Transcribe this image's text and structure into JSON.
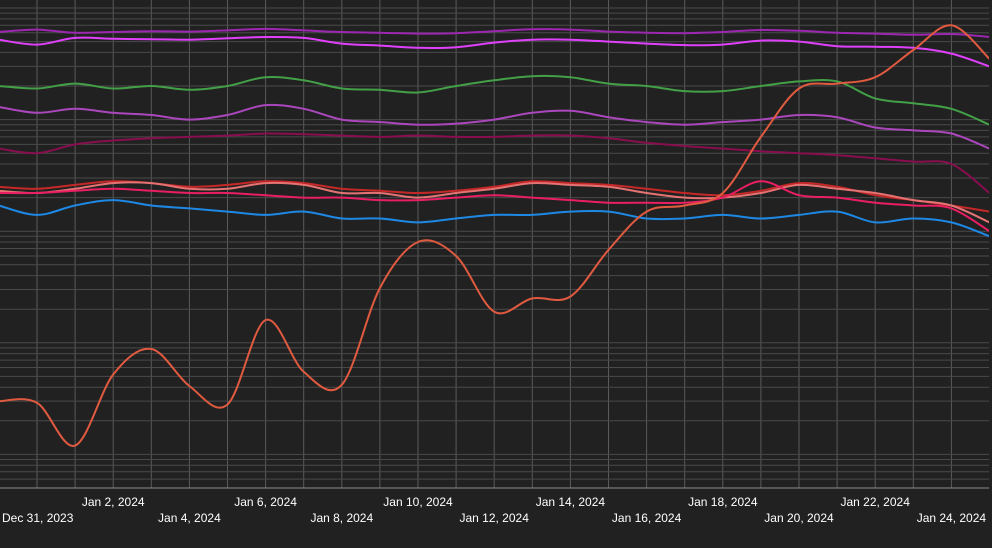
{
  "chart_data": {
    "type": "line",
    "title": "",
    "xlabel": "",
    "ylabel": "",
    "y_scale": "log",
    "y_tick_labels_visible": false,
    "grid": true,
    "background": "#212121",
    "x_tick_labels": [
      "Dec 31, 2023",
      "Jan 2, 2024",
      "Jan 4, 2024",
      "Jan 6, 2024",
      "Jan 8, 2024",
      "Jan 10, 2024",
      "Jan 12, 2024",
      "Jan 14, 2024",
      "Jan 16, 2024",
      "Jan 18, 2024",
      "Jan 20, 2024",
      "Jan 22, 2024",
      "Jan 24, 2024"
    ],
    "x": [
      "2023-12-30",
      "2023-12-31",
      "2024-01-01",
      "2024-01-02",
      "2024-01-03",
      "2024-01-04",
      "2024-01-05",
      "2024-01-06",
      "2024-01-07",
      "2024-01-08",
      "2024-01-09",
      "2024-01-10",
      "2024-01-11",
      "2024-01-12",
      "2024-01-13",
      "2024-01-14",
      "2024-01-15",
      "2024-01-16",
      "2024-01-17",
      "2024-01-18",
      "2024-01-19",
      "2024-01-20",
      "2024-01-21",
      "2024-01-22",
      "2024-01-23",
      "2024-01-24",
      "2024-01-25"
    ],
    "ylim": [
      0.05,
      1000
    ],
    "series": [
      {
        "color": "#9c27b0",
        "values": [
          610,
          640,
          600,
          610,
          620,
          615,
          630,
          650,
          630,
          610,
          600,
          590,
          595,
          620,
          645,
          640,
          615,
          600,
          595,
          610,
          635,
          625,
          600,
          590,
          575,
          585,
          550
        ]
      },
      {
        "color": "#e040fb",
        "values": [
          520,
          470,
          540,
          530,
          525,
          520,
          535,
          550,
          540,
          480,
          460,
          440,
          445,
          490,
          520,
          520,
          500,
          480,
          465,
          470,
          510,
          500,
          455,
          450,
          440,
          390,
          300
        ]
      },
      {
        "color": "#43a047",
        "values": [
          200,
          190,
          210,
          190,
          200,
          185,
          200,
          240,
          225,
          190,
          185,
          175,
          200,
          225,
          245,
          240,
          210,
          200,
          180,
          180,
          200,
          220,
          220,
          155,
          140,
          125,
          90
        ]
      },
      {
        "color": "#ab47bc",
        "values": [
          130,
          115,
          125,
          115,
          110,
          100,
          110,
          135,
          125,
          100,
          95,
          90,
          92,
          100,
          115,
          120,
          105,
          95,
          90,
          95,
          100,
          110,
          105,
          85,
          80,
          75,
          55
        ]
      },
      {
        "color": "#880e4f",
        "values": [
          55,
          50,
          60,
          65,
          68,
          70,
          72,
          75,
          74,
          72,
          70,
          72,
          70,
          70,
          72,
          72,
          68,
          62,
          58,
          55,
          52,
          50,
          48,
          45,
          42,
          40,
          22
        ]
      },
      {
        "color": "#c62828",
        "values": [
          25,
          24,
          26,
          28,
          27,
          25,
          26,
          28,
          27,
          24,
          23,
          22,
          23,
          25,
          28,
          27,
          26,
          24,
          22,
          21,
          23,
          27,
          25,
          21,
          19,
          17,
          15
        ]
      },
      {
        "color": "#e57373",
        "values": [
          23,
          22,
          24,
          27,
          27,
          24,
          24,
          27,
          26,
          22,
          22,
          20,
          22,
          24,
          27,
          26,
          25,
          22,
          20,
          20,
          22,
          26,
          24,
          22,
          19,
          17,
          12
        ]
      },
      {
        "color": "#e91e63",
        "values": [
          22,
          22,
          23,
          24,
          23,
          22,
          22,
          21,
          20,
          20,
          19,
          19,
          20,
          21,
          20,
          19,
          18,
          18,
          18,
          20,
          28,
          21,
          20,
          18,
          17,
          16,
          10
        ]
      },
      {
        "color": "#1e88e5",
        "values": [
          17,
          14,
          17,
          19,
          17,
          16,
          15,
          14,
          15,
          13,
          13,
          12,
          13,
          14,
          14,
          15,
          15,
          13,
          13,
          14,
          13,
          14,
          15,
          12,
          13,
          12,
          9
        ]
      },
      {
        "color": "#e05a40",
        "values": [
          0.3,
          0.29,
          0.12,
          0.52,
          0.88,
          0.41,
          0.28,
          1.6,
          0.55,
          0.42,
          3.1,
          8.0,
          6.0,
          1.9,
          2.5,
          2.6,
          6.8,
          15.0,
          17.0,
          22.0,
          70.0,
          190.0,
          210.0,
          240.0,
          420.0,
          700.0,
          350.0
        ]
      }
    ]
  }
}
